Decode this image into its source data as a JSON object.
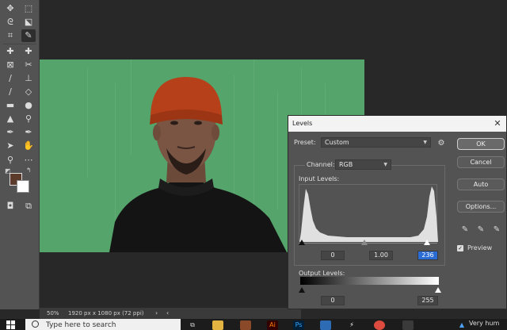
{
  "status": {
    "zoom": "50%",
    "doc_info": "1920 px x 1080 px (72 ppi)"
  },
  "taskbar": {
    "search_placeholder": "Type here to search",
    "tray_text": "Very hum"
  },
  "levels": {
    "title": "Levels",
    "preset_label": "Preset:",
    "preset_value": "Custom",
    "channel_label": "Channel:",
    "channel_value": "RGB",
    "input_levels_label": "Input Levels:",
    "input_black": "0",
    "input_gamma": "1.00",
    "input_white": "236",
    "output_levels_label": "Output Levels:",
    "output_black": "0",
    "output_white": "255",
    "buttons": {
      "ok": "OK",
      "cancel": "Cancel",
      "auto": "Auto",
      "options": "Options..."
    },
    "preview_label": "Preview",
    "preview_checked": true
  }
}
